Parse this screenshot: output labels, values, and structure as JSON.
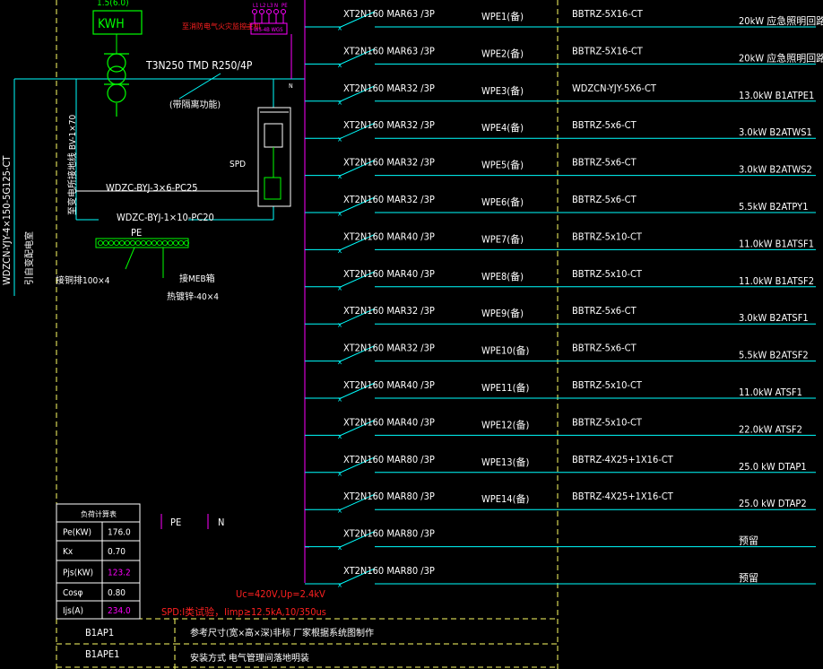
{
  "meter": {
    "top_label": "1.5(6.0)",
    "label": "KWH"
  },
  "fire_controller_label": "至消防电气火灾监控主机",
  "controller_terminals": [
    "L1",
    "L2",
    "L3",
    "N",
    "PE"
  ],
  "controller_box_label": "WS-4B WGS",
  "main_breaker": "T3N250 TMD   R250/4P",
  "main_breaker_note": "(带隔离功能)",
  "spd_label": "SPD",
  "spd_cable": "WDZC-BYJ-3×6-PC25",
  "pe_cable": "WDZC-BYJ-1×10-PC20",
  "pe_label": "PE",
  "ground_wire": "至变电所接地线 BV-1×70",
  "incoming_cable": "WDZCN-YJY-4×150-5G125-CT",
  "incoming_source": "引自变配电室",
  "copper_bar": "接铜排100×4",
  "meb_box": "接MEB箱",
  "flat_steel": "热镀锌-40×4",
  "legend": {
    "pe": "PE",
    "n": "N"
  },
  "spd_specs": {
    "line1": "Uc=420V,Up=2.4kV",
    "line2": "SPD:I类试验，Iimp≥12.5kA,10/350us"
  },
  "circuits": [
    {
      "breaker": "XT2N160 MAR63 /3P",
      "id": "WPE1",
      "tag": "(备)",
      "cable": "BBTRZ-5X16-CT",
      "load": "20kW",
      "desc": "应急照明回路-"
    },
    {
      "breaker": "XT2N160 MAR63 /3P",
      "id": "WPE2",
      "tag": "(备)",
      "cable": "BBTRZ-5X16-CT",
      "load": "20kW",
      "desc": "应急照明回路二"
    },
    {
      "breaker": "XT2N160 MAR32 /3P",
      "id": "WPE3",
      "tag": "(备)",
      "cable": "WDZCN-YJY-5X6-CT",
      "load": "13.0kW",
      "desc": "B1ATPE1"
    },
    {
      "breaker": "XT2N160 MAR32 /3P",
      "id": "WPE4",
      "tag": "(备)",
      "cable": "BBTRZ-5x6-CT",
      "load": "3.0kW",
      "desc": "B2ATWS1"
    },
    {
      "breaker": "XT2N160 MAR32 /3P",
      "id": "WPE5",
      "tag": "(备)",
      "cable": "BBTRZ-5x6-CT",
      "load": "3.0kW",
      "desc": "B2ATWS2"
    },
    {
      "breaker": "XT2N160 MAR32 /3P",
      "id": "WPE6",
      "tag": "(备)",
      "cable": "BBTRZ-5x6-CT",
      "load": "5.5kW",
      "desc": "B2ATPY1"
    },
    {
      "breaker": "XT2N160 MAR40 /3P",
      "id": "WPE7",
      "tag": "(备)",
      "cable": "BBTRZ-5x10-CT",
      "load": "11.0kW",
      "desc": "B1ATSF1"
    },
    {
      "breaker": "XT2N160 MAR40 /3P",
      "id": "WPE8",
      "tag": "(备)",
      "cable": "BBTRZ-5x10-CT",
      "load": "11.0kW",
      "desc": "B1ATSF2"
    },
    {
      "breaker": "XT2N160 MAR32 /3P",
      "id": "WPE9",
      "tag": "(备)",
      "cable": "BBTRZ-5x6-CT",
      "load": "3.0kW",
      "desc": "B2ATSF1"
    },
    {
      "breaker": "XT2N160 MAR32 /3P",
      "id": "WPE10",
      "tag": "(备)",
      "cable": "BBTRZ-5x6-CT",
      "load": "5.5kW",
      "desc": "B2ATSF2"
    },
    {
      "breaker": "XT2N160 MAR40 /3P",
      "id": "WPE11",
      "tag": "(备)",
      "cable": "BBTRZ-5x10-CT",
      "load": "11.0kW",
      "desc": "ATSF1"
    },
    {
      "breaker": "XT2N160 MAR40 /3P",
      "id": "WPE12",
      "tag": "(备)",
      "cable": "BBTRZ-5x10-CT",
      "load": "22.0kW",
      "desc": "ATSF2"
    },
    {
      "breaker": "XT2N160 MAR80 /3P",
      "id": "WPE13",
      "tag": "(备)",
      "cable": "BBTRZ-4X25+1X16-CT",
      "load": "25.0 kW",
      "desc": "DTAP1"
    },
    {
      "breaker": "XT2N160 MAR80 /3P",
      "id": "WPE14",
      "tag": "(备)",
      "cable": "BBTRZ-4X25+1X16-CT",
      "load": "25.0 kW",
      "desc": "DTAP2"
    },
    {
      "breaker": "XT2N160 MAR80 /3P",
      "id": "",
      "tag": "",
      "cable": "",
      "load": "",
      "desc": "预留"
    },
    {
      "breaker": "XT2N160 MAR80 /3P",
      "id": "",
      "tag": "",
      "cable": "",
      "load": "",
      "desc": "预留"
    }
  ],
  "calc_table": {
    "title": "负荷计算表",
    "rows": [
      {
        "label": "Pe(KW)",
        "value": "176.0"
      },
      {
        "label": "Kx",
        "value": "0.70"
      },
      {
        "label": "Pjs(KW)",
        "value": "123.2"
      },
      {
        "label": "Cosφ",
        "value": "0.80"
      },
      {
        "label": "Ijs(A)",
        "value": "234.0"
      }
    ]
  },
  "footer": {
    "panel_ids": [
      "B1AP1",
      "B1APE1"
    ],
    "notes": [
      "参考尺寸(宽×高×深)非标 厂家根据系统图制作",
      "安装方式 电气管理间落地明装"
    ]
  },
  "colors": {
    "background": "#000000",
    "text": "#ffffff",
    "cyan": "#00ffff",
    "magenta": "#ff00ff",
    "green": "#00ff00",
    "yellow": "#ffff00",
    "red": "#ff2020",
    "dashed_border": "#ffff66"
  }
}
